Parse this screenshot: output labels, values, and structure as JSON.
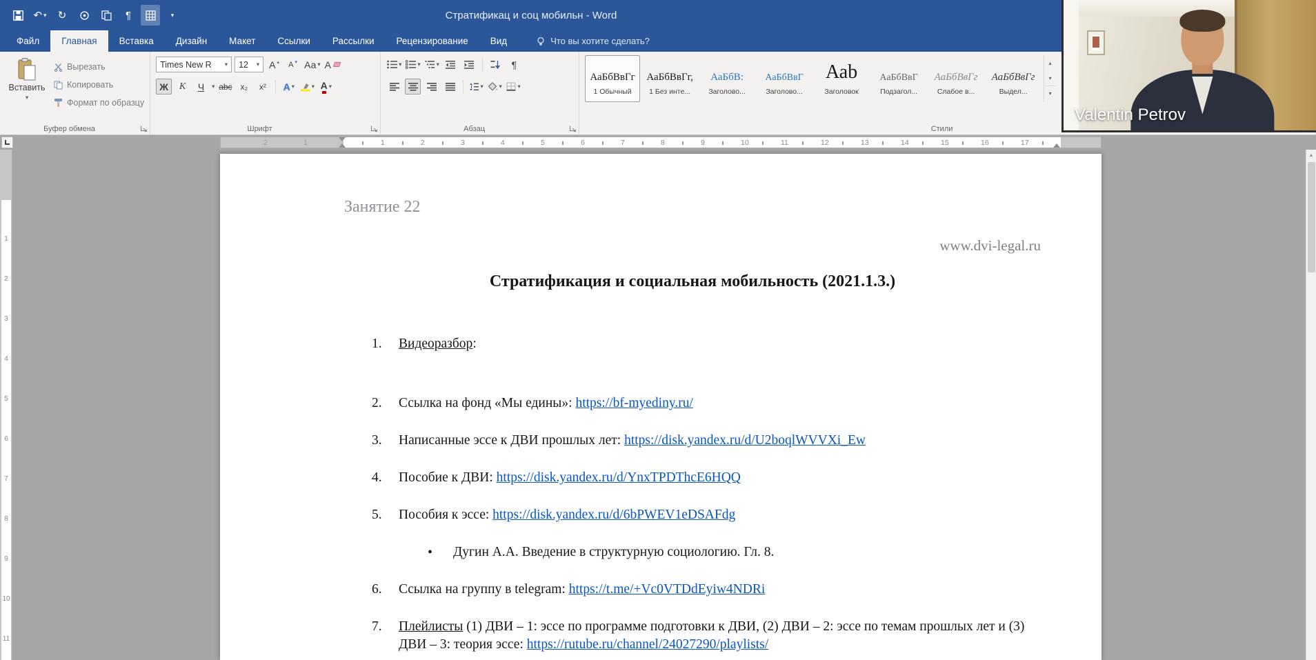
{
  "titlebar": {
    "title": "Стратификац и соц мобильн - Word",
    "qat_icons": [
      "save",
      "undo",
      "redo",
      "touch-mode",
      "copy",
      "paragraph-mark",
      "table",
      "customize-quick-access"
    ]
  },
  "icons": {
    "undo": "↶",
    "redo": "↻",
    "pilcrow": "¶",
    "dropdown": "▾",
    "up": "▴",
    "bold": "Ж",
    "italic": "К",
    "underline": "Ч",
    "strikethrough": "abc",
    "subscript": "х₂",
    "superscript": "х²",
    "text_effects": "А",
    "font_color": "А",
    "change_case": "Аа",
    "grow_font": "А",
    "shrink_font": "А",
    "clear_formatting": "А",
    "bullet": "•"
  },
  "ribbon": {
    "tabs": [
      {
        "label": "Файл"
      },
      {
        "label": "Главная",
        "active": true
      },
      {
        "label": "Вставка"
      },
      {
        "label": "Дизайн"
      },
      {
        "label": "Макет"
      },
      {
        "label": "Ссылки"
      },
      {
        "label": "Рассылки"
      },
      {
        "label": "Рецензирование"
      },
      {
        "label": "Вид"
      }
    ],
    "tell_me": "Что вы хотите сделать?",
    "clipboard": {
      "group_label": "Буфер обмена",
      "paste": "Вставить",
      "cut": "Вырезать",
      "copy": "Копировать",
      "format_painter": "Формат по образцу"
    },
    "font": {
      "group_label": "Шрифт",
      "font_name": "Times New R",
      "font_size": "12"
    },
    "paragraph": {
      "group_label": "Абзац"
    },
    "styles": {
      "group_label": "Стили",
      "items": [
        {
          "sample": "АаБбВвГг",
          "label": "1 Обычный",
          "selected": true,
          "cls": "normal"
        },
        {
          "sample": "АаБбВвГг,",
          "label": "1 Без инте...",
          "cls": "normal"
        },
        {
          "sample": "АаБбВ:",
          "label": "Заголово...",
          "cls": "h1"
        },
        {
          "sample": "АаБбВвГ",
          "label": "Заголово...",
          "cls": "h2"
        },
        {
          "sample": "Ааb",
          "label": "Заголовок",
          "cls": "title"
        },
        {
          "sample": "АаБбВвГ",
          "label": "Подзагол...",
          "cls": "subtitle"
        },
        {
          "sample": "АаБбВвГг",
          "label": "Слабое в...",
          "cls": "subtle"
        },
        {
          "sample": "АаБбВвГг",
          "label": "Выдел...",
          "cls": "emphasis"
        }
      ]
    }
  },
  "ruler": {
    "margin_numbers": [
      "1",
      "2"
    ],
    "numbers": [
      "1",
      "2",
      "3",
      "4",
      "5",
      "6",
      "7",
      "8",
      "9",
      "10",
      "11",
      "12",
      "13",
      "14",
      "15",
      "16",
      "17"
    ],
    "v_numbers": [
      "1",
      "2",
      "3",
      "4",
      "5",
      "6",
      "7",
      "8",
      "9",
      "10",
      "11"
    ]
  },
  "document": {
    "header_left": "Занятие 22",
    "header_right": "www.dvi-legal.ru",
    "title": "Стратификация и социальная мобильность (2021.1.3.)",
    "items": [
      {
        "type": "num",
        "n": "1.",
        "gap": true,
        "parts": [
          {
            "t": "Видеоразбор",
            "u": true
          },
          {
            "t": ":"
          }
        ]
      },
      {
        "type": "num",
        "n": "2.",
        "parts": [
          {
            "t": "Ссылка на фонд «Мы едины»: "
          },
          {
            "t": "https://bf-myediny.ru/",
            "link": true
          }
        ]
      },
      {
        "type": "num",
        "n": "3.",
        "parts": [
          {
            "t": "Написанные эссе к ДВИ прошлых лет: "
          },
          {
            "t": "https://disk.yandex.ru/d/U2boqlWVVXi_Ew",
            "link": true
          }
        ]
      },
      {
        "type": "num",
        "n": "4.",
        "parts": [
          {
            "t": "Пособие к ДВИ: "
          },
          {
            "t": "https://disk.yandex.ru/d/YnxTPDThcE6HQQ",
            "link": true
          }
        ]
      },
      {
        "type": "num",
        "n": "5.",
        "parts": [
          {
            "t": "Пособия к эссе: "
          },
          {
            "t": "https://disk.yandex.ru/d/6bPWEV1eDSAFdg",
            "link": true
          }
        ]
      },
      {
        "type": "bullet",
        "parts": [
          {
            "t": "Дугин А.А. Введение в структурную социологию. Гл. 8."
          }
        ]
      },
      {
        "type": "num",
        "n": "6.",
        "parts": [
          {
            "t": "Ссылка на группу в telegram: "
          },
          {
            "t": "https://t.me/+Vc0VTDdEyiw4NDRi",
            "link": true
          }
        ]
      },
      {
        "type": "num",
        "n": "7.",
        "parts": [
          {
            "t": "Плейлисты",
            "u": true
          },
          {
            "t": " (1) ДВИ – 1: эссе по программе подготовки к ДВИ, (2) ДВИ – 2: эссе по темам прошлых лет и (3) ДВИ – 3: теория эссе: "
          },
          {
            "t": "https://rutube.ru/channel/24027290/playlists/",
            "link": true
          }
        ]
      }
    ]
  },
  "webcam": {
    "name": "Valentin Petrov"
  },
  "colors": {
    "accent": "#2b579a",
    "hyperlink": "#0a56c2",
    "heading": "#2e74b5",
    "font_color_swatch": "#c00000"
  }
}
